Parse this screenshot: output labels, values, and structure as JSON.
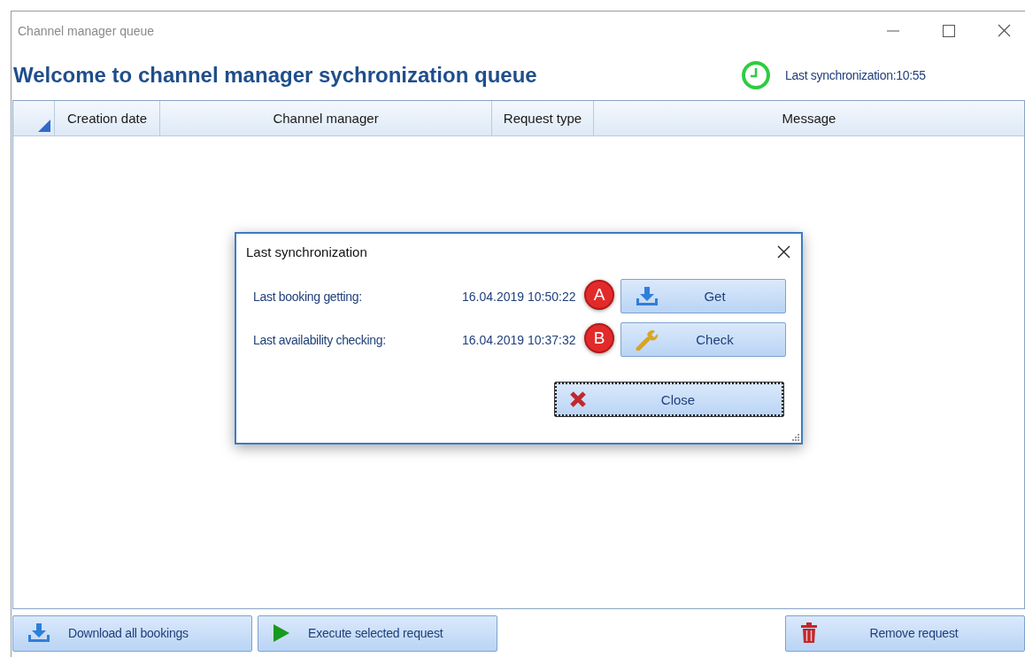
{
  "window": {
    "title": "Channel manager queue"
  },
  "heading": "Welcome to channel manager sychronization queue",
  "last_sync": "Last synchronization:10:55",
  "table": {
    "columns": [
      "Creation date",
      "Channel manager",
      "Request type",
      "Message"
    ]
  },
  "dialog": {
    "title": "Last synchronization",
    "rows": [
      {
        "label": "Last booking getting:",
        "value": "16.04.2019 10:50:22",
        "badge": "A",
        "button": {
          "label": "Get",
          "kind": "get"
        }
      },
      {
        "label": "Last availability checking:",
        "value": "16.04.2019 10:37:32",
        "badge": "B",
        "button": {
          "label": "Check",
          "kind": "check"
        }
      }
    ],
    "close_button": {
      "label": "Close",
      "focused": true
    }
  },
  "footer_buttons": [
    {
      "label": "Download all bookings",
      "kind": "download"
    },
    {
      "label": "Execute selected request",
      "kind": "execute"
    },
    {
      "label": "Remove request",
      "kind": "remove"
    }
  ]
}
